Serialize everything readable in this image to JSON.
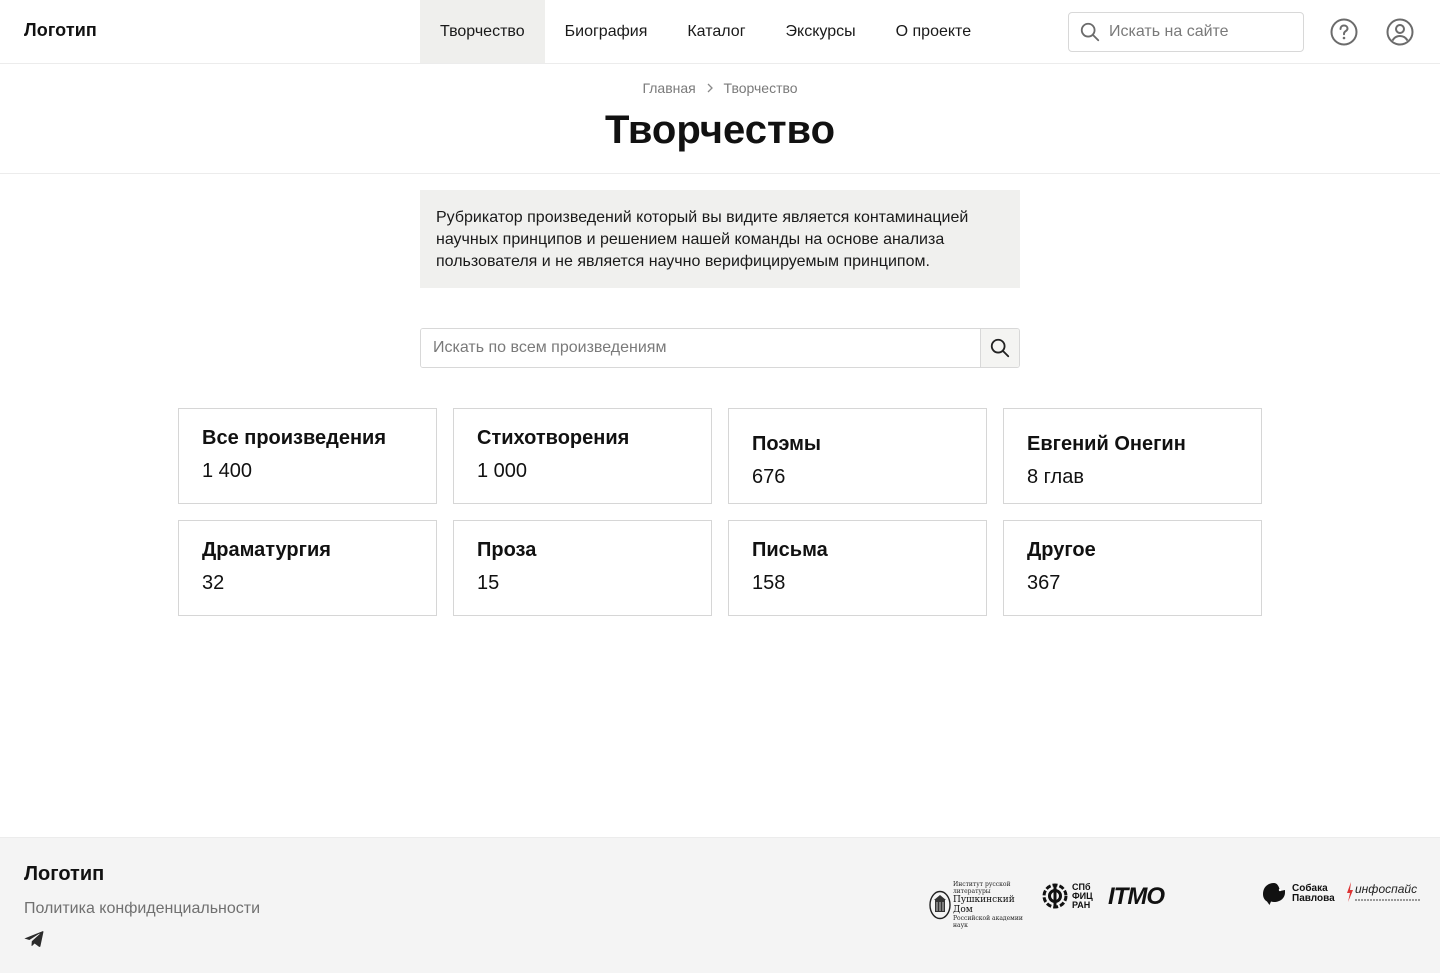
{
  "header": {
    "logo": "Логотип",
    "nav": [
      {
        "label": "Творчество",
        "active": true
      },
      {
        "label": "Биография",
        "active": false
      },
      {
        "label": "Каталог",
        "active": false
      },
      {
        "label": "Экскурсы",
        "active": false
      },
      {
        "label": "О проекте",
        "active": false
      }
    ],
    "search": {
      "placeholder": "Искать на сайте"
    },
    "icons": [
      "help-circle-icon",
      "user-circle-icon"
    ]
  },
  "breadcrumb": {
    "home": "Главная",
    "current": "Творчество"
  },
  "page_title": "Творчество",
  "notice": "Рубрикатор произведений который вы видите является контаминацией научных принципов и решением нашей команды на основе анализа пользователя и не является научно верифицируемым принципом.",
  "works_search": {
    "placeholder": "Искать по всем произведениям"
  },
  "categories": [
    {
      "title": "Все произведения",
      "count": "1 400"
    },
    {
      "title": "Стихотворения",
      "count": "1 000"
    },
    {
      "title": "Поэмы",
      "count": "676"
    },
    {
      "title": "Евгений Онегин",
      "count": "8 глав"
    },
    {
      "title": "Драматургия",
      "count": "32"
    },
    {
      "title": "Проза",
      "count": "15"
    },
    {
      "title": "Письма",
      "count": "158"
    },
    {
      "title": "Другое",
      "count": "367"
    }
  ],
  "footer": {
    "logo": "Логотип",
    "privacy": "Политика конфиденциальности",
    "partners": {
      "pushkin_house": [
        "Институт русской литературы",
        "Пушкинский Дом",
        "Российской академии наук"
      ],
      "spb_fic": [
        "СПб",
        "ФИЦ",
        "РАН"
      ],
      "itmo": "ITMO",
      "sobaka": [
        "Собака",
        "Павлова"
      ],
      "infospace": "инфоспайс"
    }
  }
}
